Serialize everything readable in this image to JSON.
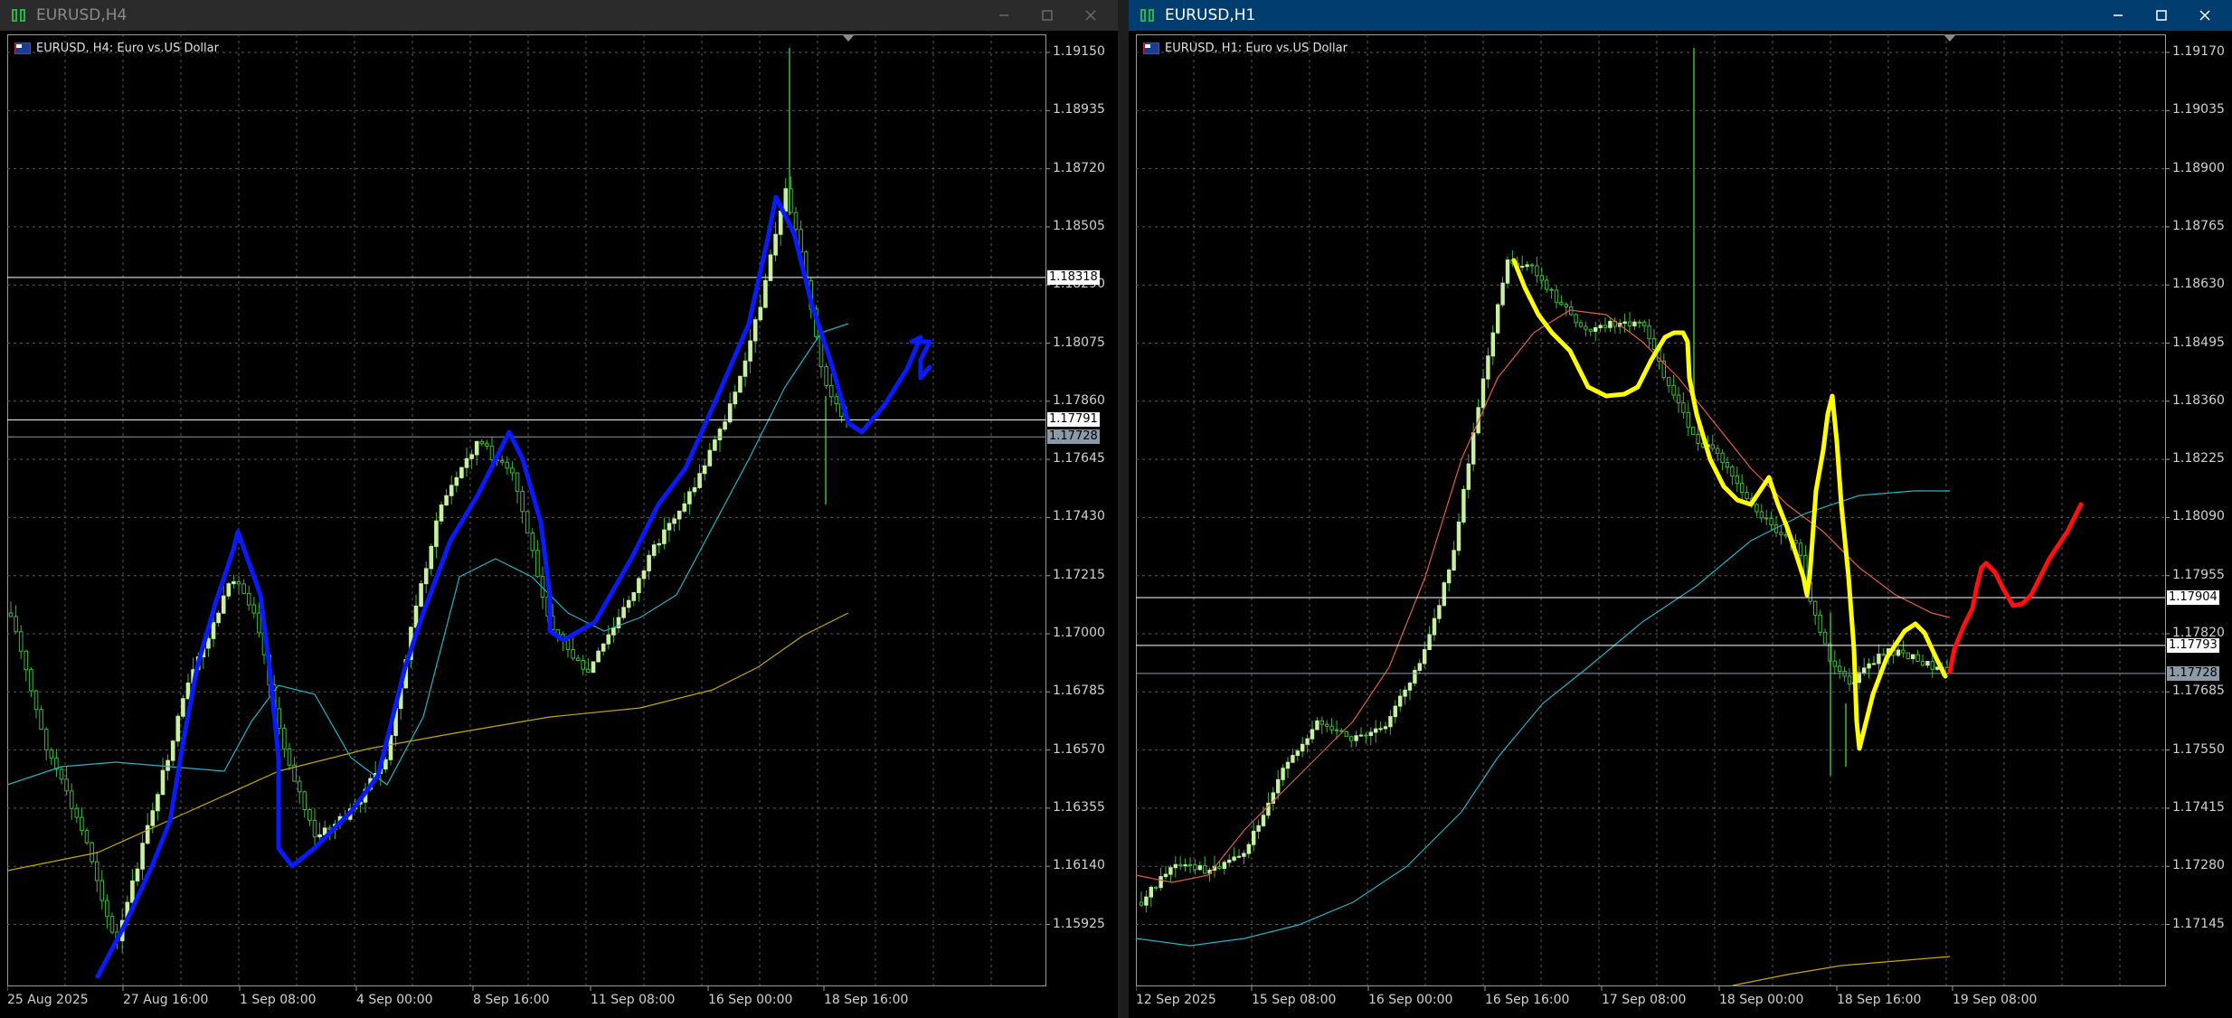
{
  "left_window": {
    "title": "EURUSD,H4",
    "chart_label": "EURUSD, H4:  Euro vs.US Dollar",
    "price_axis": [
      "1.19150",
      "1.18935",
      "1.18720",
      "1.18505",
      "1.18290",
      "1.18075",
      "1.17860",
      "1.17645",
      "1.17430",
      "1.17215",
      "1.17000",
      "1.16785",
      "1.16570",
      "1.16355",
      "1.16140",
      "1.15925"
    ],
    "time_axis": [
      "25 Aug 2025",
      "27 Aug 16:00",
      "1 Sep 08:00",
      "4 Sep 00:00",
      "8 Sep 16:00",
      "11 Sep 08:00",
      "16 Sep 00:00",
      "18 Sep 16:00"
    ],
    "horizontal_lines": [
      {
        "price": "1.18318",
        "color": "#ffffff"
      },
      {
        "price": "1.17791",
        "color": "#ffffff"
      },
      {
        "price": "1.17728",
        "color": "#8a9aa8"
      }
    ],
    "ma_colors": {
      "fast": "#22b5c8",
      "slow": "#c8a800"
    },
    "drawing_color": "#0a1aff"
  },
  "right_window": {
    "title": "EURUSD,H1",
    "chart_label": "EURUSD, H1:  Euro vs.US Dollar",
    "price_axis": [
      "1.19170",
      "1.19035",
      "1.18900",
      "1.18765",
      "1.18630",
      "1.18495",
      "1.18360",
      "1.18225",
      "1.18090",
      "1.17955",
      "1.17820",
      "1.17685",
      "1.17550",
      "1.17415",
      "1.17280",
      "1.17145"
    ],
    "time_axis": [
      "12 Sep 2025",
      "15 Sep 08:00",
      "16 Sep 00:00",
      "16 Sep 16:00",
      "17 Sep 08:00",
      "18 Sep 00:00",
      "18 Sep 16:00",
      "19 Sep 08:00"
    ],
    "horizontal_lines": [
      {
        "price": "1.17904",
        "color": "#ffffff"
      },
      {
        "price": "1.17793",
        "color": "#ffffff"
      },
      {
        "price": "1.17728",
        "color": "#8a9aa8"
      }
    ],
    "ma_colors": {
      "fast": "#e0603c",
      "mid": "#22b5c8",
      "slow": "#c8a800"
    },
    "drawing_colors": {
      "yellow": "#ffff00",
      "red": "#ff1010"
    }
  },
  "window_controls": [
    "minimize",
    "maximize",
    "close"
  ]
}
